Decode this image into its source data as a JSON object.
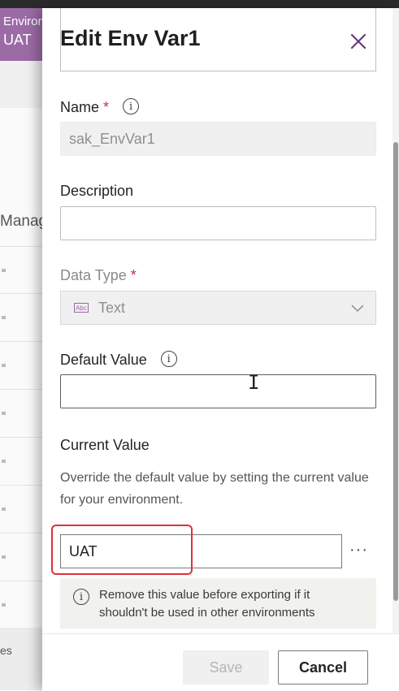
{
  "background": {
    "env_label": "Environ",
    "env_name": "UAT",
    "manage_label": "Manage",
    "footer_label": "es"
  },
  "panel": {
    "title": "Edit Env Var1",
    "name": {
      "label": "Name",
      "required_mark": "*",
      "value": "sak_EnvVar1"
    },
    "description": {
      "label": "Description",
      "value": ""
    },
    "data_type": {
      "label": "Data Type",
      "required_mark": "*",
      "icon_text": "Abc",
      "value": "Text"
    },
    "default_value": {
      "label": "Default Value",
      "value": ""
    },
    "current_value": {
      "label": "Current Value",
      "description": "Override the default value by setting the current value for your environment.",
      "value": "UAT",
      "more_label": "···",
      "notice": "Remove this value before exporting if it shouldn't be used in other environments"
    },
    "buttons": {
      "save": "Save",
      "cancel": "Cancel"
    },
    "info_glyph": "i"
  },
  "colors": {
    "accent": "#6b3a7a",
    "env_badge": "#9c6ba6",
    "required": "#c4314b",
    "highlight": "#e0303a"
  }
}
